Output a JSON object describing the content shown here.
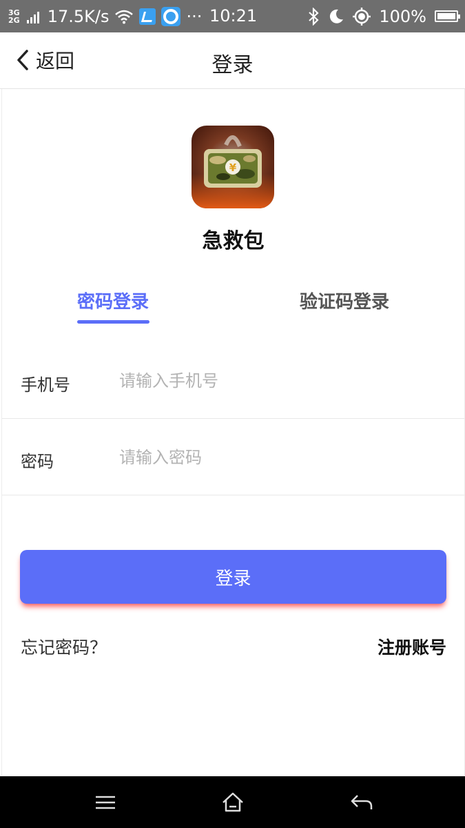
{
  "status_bar": {
    "network_top": "3G",
    "network_bottom": "2G",
    "speed": "17.5K/s",
    "more": "···",
    "time": "10:21",
    "battery": "100%"
  },
  "header": {
    "back_label": "返回",
    "title": "登录"
  },
  "app": {
    "name": "急救包",
    "logo_icon": "camouflage-wallet-yuan-icon"
  },
  "tabs": [
    {
      "label": "密码登录",
      "active": true
    },
    {
      "label": "验证码登录",
      "active": false
    }
  ],
  "form": {
    "phone": {
      "label": "手机号",
      "placeholder": "请输入手机号",
      "value": ""
    },
    "password": {
      "label": "密码",
      "placeholder": "请输入密码",
      "value": ""
    }
  },
  "actions": {
    "login_label": "登录",
    "forgot_label": "忘记密码？",
    "register_label": "注册账号"
  },
  "colors": {
    "accent": "#5b6ef8",
    "status_bar": "#6e6e6e",
    "nav_bar": "#000000"
  },
  "nav_bar": {
    "icons": [
      "menu-icon",
      "home-icon",
      "back-arrow-icon"
    ]
  }
}
